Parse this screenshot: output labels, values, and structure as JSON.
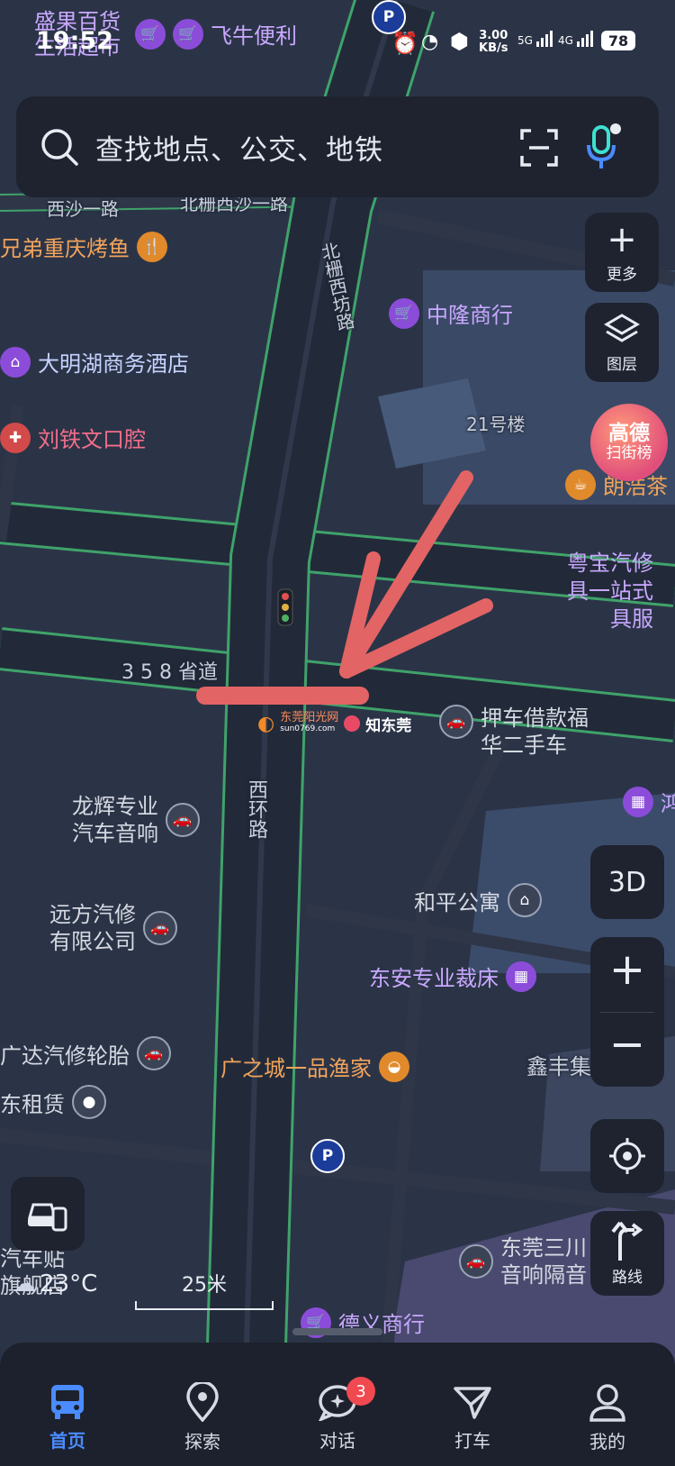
{
  "status_bar": {
    "time": "19:52",
    "net_speed_value": "3.00",
    "net_speed_unit": "KB/s",
    "sim1": "5G",
    "sim2": "4G",
    "battery": "78",
    "bg_text_1": "盛果百货",
    "bg_text_2": "生活超市"
  },
  "search": {
    "placeholder": "查找地点、公交、地铁"
  },
  "right_controls": {
    "more_label": "更多",
    "layers_label": "图层",
    "gaode_line1": "高德",
    "gaode_line2": "扫街榜",
    "mode_3d": "3D",
    "route_label": "路线"
  },
  "scale": {
    "label": "25米"
  },
  "weather": {
    "temp": "23°C"
  },
  "roads": {
    "xisha": "西沙一路",
    "beishan_top": "北栅西沙一路",
    "beishan_xifang": "北栅西坊路",
    "provincial": "3 5 8 省道",
    "xihuan": "西环路"
  },
  "pois": {
    "feiniu": "飞牛便利",
    "chongqing": "兄弟重庆烤鱼",
    "zhonglong": "中隆商行",
    "daminghu": "大明湖商务酒店",
    "building21": "21号楼",
    "liutiewen": "刘铁文口腔",
    "langhao": "朗浩茶",
    "yuebao_1": "粤宝汽修",
    "yuebao_2": "具一站式",
    "yuebao_3": "具服",
    "yache_1": "押车借款福",
    "yache_2": "华二手车",
    "longhui_1": "龙辉专业",
    "longhui_2": "汽车音响",
    "yuanfang_1": "远方汽修",
    "yuanfang_2": "有限公司",
    "heping": "和平公寓",
    "dongan": "东安专业裁床",
    "guangda": "广达汽修轮胎",
    "guangzhicheng": "广之城一品渔家",
    "xinfeng": "鑫丰集",
    "zulin": "东租赁",
    "dongguan_1": "东莞三川",
    "dongguan_2": "音响隔音",
    "qichetie_1": "汽车贴",
    "qichetie_2": "旗舰店",
    "deyi": "德义商行",
    "edge_right": "鸿"
  },
  "watermark": {
    "brand1": "东莞阳光网",
    "brand1_sub": "sun0769.com",
    "brand2": "知东莞"
  },
  "tabs": [
    {
      "label": "首页",
      "icon": "bus-icon",
      "active": true
    },
    {
      "label": "探索",
      "icon": "location-pin-icon",
      "active": false
    },
    {
      "label": "对话",
      "icon": "chat-bubble-icon",
      "active": false,
      "badge": "3"
    },
    {
      "label": "打车",
      "icon": "taxi-arrow-icon",
      "active": false
    },
    {
      "label": "我的",
      "icon": "user-icon",
      "active": false
    }
  ],
  "colors": {
    "map_bg": "#2b3447",
    "road": "#3a4254",
    "road_edge": "#3fa36a",
    "annotation_red": "#e36464",
    "accent_blue": "#4a8cff"
  }
}
